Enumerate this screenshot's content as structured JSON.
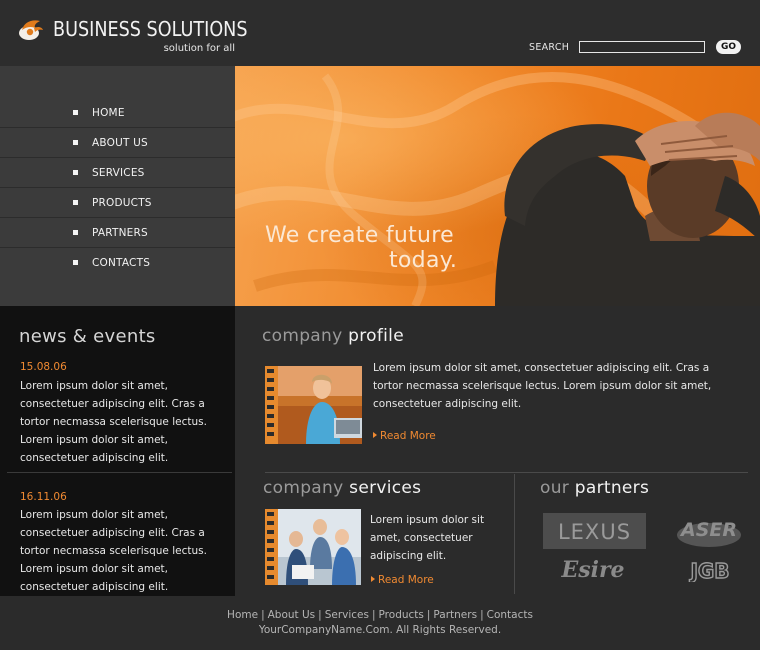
{
  "header": {
    "title": "BUSINESS SOLUTIONS",
    "subtitle": "solution for all",
    "search_label": "SEARCH",
    "search_value": "",
    "go_label": "GO",
    "accent": "#f08a32"
  },
  "nav": {
    "items": [
      {
        "label": "HOME"
      },
      {
        "label": "ABOUT US"
      },
      {
        "label": "SERVICES"
      },
      {
        "label": "PRODUCTS"
      },
      {
        "label": "PARTNERS"
      },
      {
        "label": "CONTACTS"
      }
    ]
  },
  "hero": {
    "line1": "We create future",
    "line2": "today."
  },
  "news": {
    "heading": "news & events",
    "items": [
      {
        "date": "15.08.06",
        "text": "Lorem ipsum dolor sit amet, consectetuer adipiscing elit. Cras a tortor necmassa scelerisque lectus.  Lorem ipsum dolor sit amet, consectetuer adipiscing elit."
      },
      {
        "date": "16.11.06",
        "text": "Lorem ipsum dolor sit amet, consectetuer adipiscing elit. Cras a tortor necmassa scelerisque lectus.  Lorem ipsum dolor sit amet, consectetuer adipiscing elit."
      }
    ]
  },
  "profile": {
    "heading_light": "company ",
    "heading_bold": "profile",
    "text": "Lorem ipsum dolor sit amet, consectetuer adipiscing elit. Cras a tortor necmassa scelerisque lectus.  Lorem ipsum dolor sit amet, consectetuer adipiscing elit.",
    "read_more": "Read More"
  },
  "services": {
    "heading_light": "company ",
    "heading_bold": "services",
    "text": "Lorem ipsum dolor sit amet, consectetuer adipiscing elit.",
    "read_more": "Read More"
  },
  "partners": {
    "heading_light": "our ",
    "heading_bold": "partners",
    "logos": [
      "LEXUS",
      "ASER",
      "Esire",
      "JGB"
    ]
  },
  "footer": {
    "links": [
      "Home",
      "About Us",
      "Services",
      "Products",
      "Partners",
      "Contacts"
    ],
    "copyright": "YourCompanyName.Com. All Rights Reserved."
  }
}
